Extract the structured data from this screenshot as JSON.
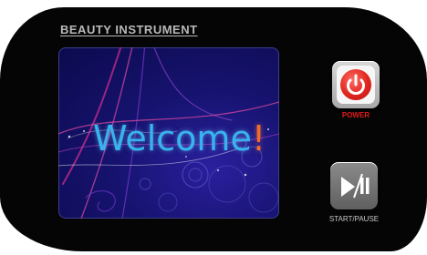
{
  "panel": {
    "brand_label": "BEAUTY INSTRUMENT"
  },
  "screen": {
    "welcome_text": "Welcome",
    "welcome_punctuation": "!",
    "accent_colors": {
      "text": "#37b4ef",
      "punctuation": "#f36b2a",
      "background": "#16136f"
    }
  },
  "controls": {
    "power": {
      "label": "POWER",
      "icon": "power-icon",
      "color": "#e31b1b"
    },
    "start_pause": {
      "label": "START/PAUSE",
      "icon": "play-pause-icon"
    }
  }
}
